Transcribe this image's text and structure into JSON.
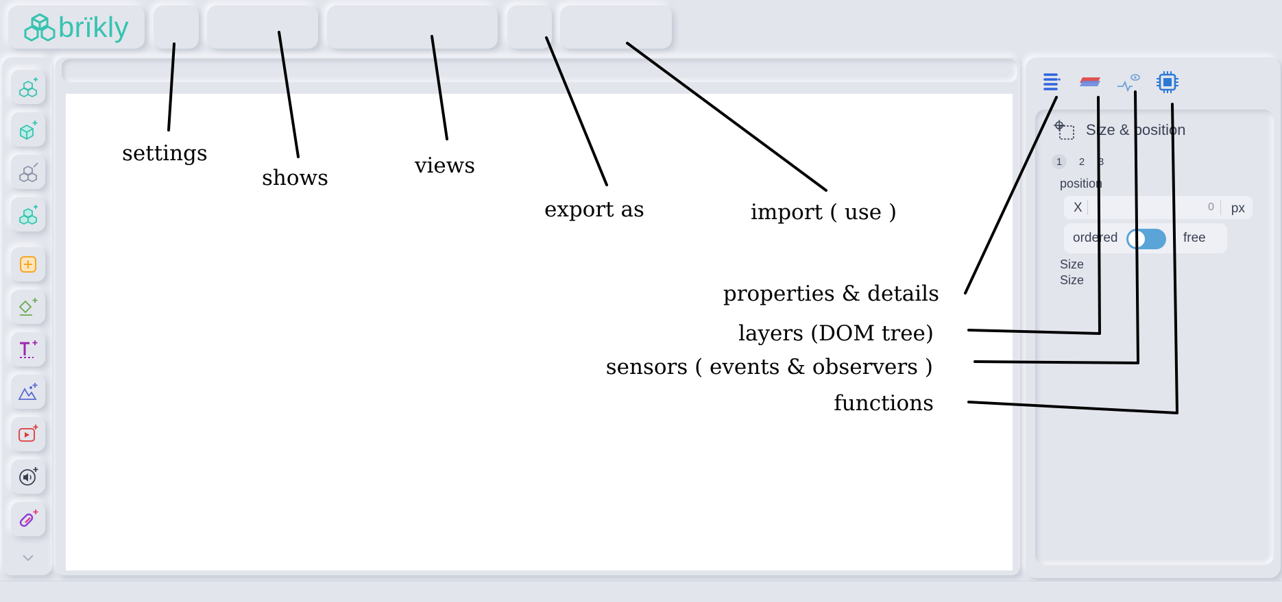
{
  "brand": {
    "name": "brïkly",
    "color": "#36c3b0"
  },
  "toolbar": {
    "items": [
      {
        "name": "settings-menu-button",
        "label": ""
      },
      {
        "name": "shows-menu-button",
        "label": ""
      },
      {
        "name": "views-menu-button",
        "label": ""
      },
      {
        "name": "export-menu-button",
        "label": ""
      },
      {
        "name": "import-menu-button",
        "label": ""
      }
    ]
  },
  "sidebar": {
    "tools": [
      {
        "name": "add-component-button",
        "icon": "cubes-plus-icon"
      },
      {
        "name": "add-cube-button",
        "icon": "cube-plus-icon"
      },
      {
        "name": "edit-components-button",
        "icon": "cubes-edit-icon"
      },
      {
        "name": "add-group-button",
        "icon": "cubes-group-plus-icon"
      },
      {
        "name": "add-box-button",
        "icon": "square-plus-icon"
      },
      {
        "name": "add-shape-button",
        "icon": "shape-plus-icon"
      },
      {
        "name": "add-text-button",
        "icon": "text-plus-icon"
      },
      {
        "name": "add-image-button",
        "icon": "image-plus-icon"
      },
      {
        "name": "add-video-button",
        "icon": "video-plus-icon"
      },
      {
        "name": "add-audio-button",
        "icon": "audio-plus-icon"
      },
      {
        "name": "add-link-button",
        "icon": "link-plus-icon"
      }
    ],
    "more_icon": "chevron-down-icon"
  },
  "panel": {
    "tabs": [
      {
        "name": "tab-properties",
        "icon": "properties-list-icon",
        "color": "#2f63e0"
      },
      {
        "name": "tab-layers",
        "icon": "layers-icon",
        "color": "#e05252"
      },
      {
        "name": "tab-sensors",
        "icon": "sensor-eye-icon",
        "color": "#6a9fd6"
      },
      {
        "name": "tab-functions",
        "icon": "chip-icon",
        "color": "#2b78d6"
      }
    ],
    "section_title": "Size & position",
    "steps": [
      "1",
      "2",
      "3"
    ],
    "position_label": "position",
    "x_label": "X",
    "x_value": "0",
    "x_unit": "px",
    "mode_left": "ordered",
    "mode_right": "free",
    "size_label_1": "Size",
    "size_label_2": "Size",
    "toggle_color": "#5aa4d8"
  },
  "annotations": {
    "settings": "settings",
    "shows": "shows",
    "views": "views",
    "export": "export as",
    "import": "import ( use )",
    "properties": "properties & details",
    "layers": "layers (DOM tree)",
    "sensors": "sensors ( events & observers )",
    "functions": "functions"
  }
}
